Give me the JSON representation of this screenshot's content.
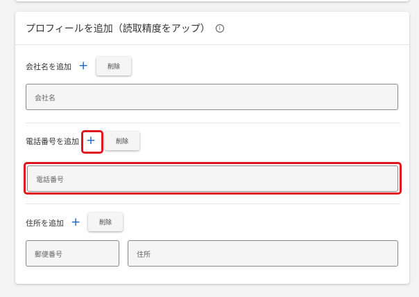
{
  "profile_card": {
    "title": "プロフィールを追加（読取精度をアップ）",
    "info_icon": "i",
    "company": {
      "add_label": "会社名を追加",
      "add_icon": "+",
      "delete_label": "削除",
      "placeholder": "会社名"
    },
    "phone": {
      "add_label": "電話番号を追加",
      "add_icon": "+",
      "delete_label": "削除",
      "placeholder": "電話番号"
    },
    "address": {
      "add_label": "住所を追加",
      "add_icon": "+",
      "delete_label": "削除",
      "postal_placeholder": "郵便番号",
      "address_placeholder": "住所"
    }
  },
  "colors": {
    "accent_plus": "#1565c0",
    "highlight": "#e0141e"
  }
}
